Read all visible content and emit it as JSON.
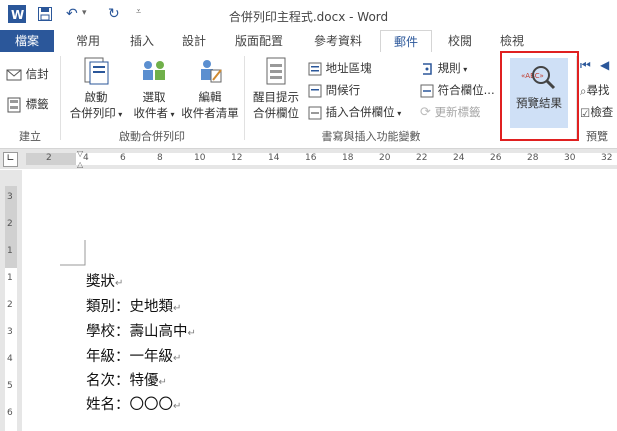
{
  "window": {
    "title": "合併列印主程式.docx - Word"
  },
  "tabs": [
    "檔案",
    "常用",
    "插入",
    "設計",
    "版面配置",
    "參考資料",
    "郵件",
    "校閱",
    "檢視"
  ],
  "ribbon": {
    "group_create": {
      "label": "建立",
      "envelopes": "信封",
      "labels": "標籤"
    },
    "group_start": {
      "label": "啟動合併列印",
      "start_merge": [
        "啟動",
        "合併列印"
      ],
      "select_recipients": [
        "選取",
        "收件者"
      ],
      "edit_list": [
        "編輯",
        "收件者清單"
      ]
    },
    "group_write": {
      "label": "書寫與插入功能變數",
      "highlight": [
        "醒目提示",
        "合併欄位"
      ],
      "address_block": "地址區塊",
      "greeting_line": "問候行",
      "insert_field": "插入合併欄位",
      "rules": "規則",
      "match_fields": "符合欄位...",
      "update_labels": "更新標籤"
    },
    "group_preview": {
      "label": "預覽",
      "preview_results": "預覽結果",
      "find": "尋找",
      "check": "檢查"
    }
  },
  "ruler": {
    "h_numbers": [
      "2",
      "4",
      "6",
      "8",
      "10",
      "12",
      "14",
      "16",
      "18",
      "20",
      "22",
      "24",
      "26",
      "28",
      "30",
      "32"
    ],
    "v_numbers": [
      "3",
      "2",
      "1",
      "1",
      "2",
      "3",
      "4",
      "5",
      "6"
    ]
  },
  "document": {
    "lines": [
      "獎狀",
      "類別：史地類",
      "學校：壽山高中",
      "年級：一年級",
      "名次：特優",
      "姓名：〇〇〇"
    ],
    "para_mark": "↵"
  }
}
